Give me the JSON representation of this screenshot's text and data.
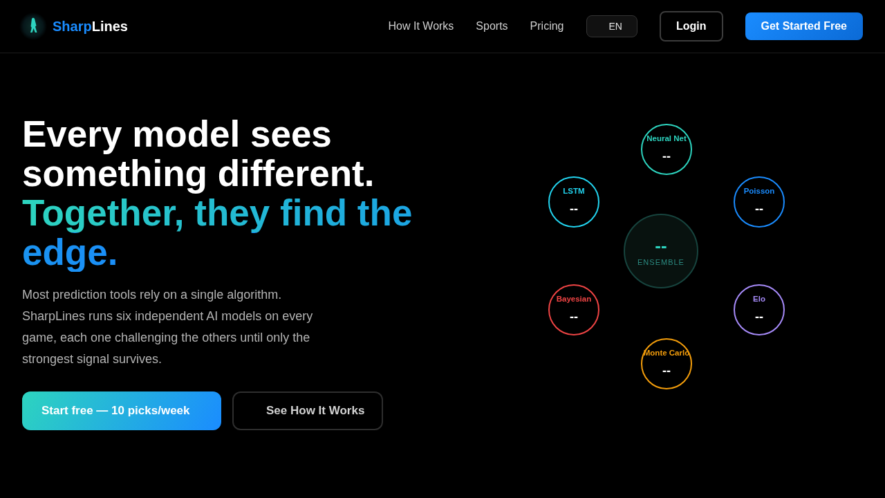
{
  "nav": {
    "brand_parts": [
      "Sharp",
      "Lines"
    ],
    "links": [
      "How It Works",
      "Sports",
      "Pricing"
    ],
    "language": "EN",
    "login": "Login",
    "cta": "Get Started Free"
  },
  "hero": {
    "headline": "Every model sees something different.",
    "headline_accent": "Together, they find the edge.",
    "description": "Most prediction tools rely on a single algorithm. SharpLines runs six independent AI models on every game, each one challenging the others until only the strongest signal survives.",
    "primary_button": "Start free — 10 picks/week",
    "secondary_button": "See How It Works"
  },
  "ensemble": {
    "value": "--",
    "label": "ENSEMBLE"
  },
  "models": [
    {
      "name": "Neural Net",
      "value": "--",
      "color": "#2dd4bf"
    },
    {
      "name": "LSTM",
      "value": "--",
      "color": "#22d3ee"
    },
    {
      "name": "Poisson",
      "value": "--",
      "color": "#1a8cff"
    },
    {
      "name": "Bayesian",
      "value": "--",
      "color": "#ef4444"
    },
    {
      "name": "Elo",
      "value": "--",
      "color": "#a78bfa"
    },
    {
      "name": "Monte Carlo",
      "value": "--",
      "color": "#f59e0b"
    }
  ]
}
